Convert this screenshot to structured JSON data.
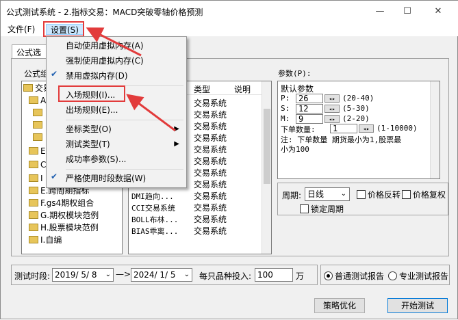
{
  "window": {
    "title": "公式测试系统 - 2.指标交易：MACD突破零轴价格预测",
    "controls": {
      "minimize": "—",
      "maximize": "☐",
      "close": "✕"
    }
  },
  "menubar": {
    "file": "文件(F)",
    "settings": "设置(S)"
  },
  "settings_menu": [
    {
      "label": "自动使用虚拟内存(A)",
      "checked": false
    },
    {
      "label": "强制使用虚拟内存(C)",
      "checked": false
    },
    {
      "label": "禁用虚拟内存(D)",
      "checked": true
    },
    {
      "label": "入场规则(I)...",
      "checked": false
    },
    {
      "label": "出场规则(E)...",
      "checked": false
    },
    {
      "label": "坐标类型(O)",
      "submenu": true
    },
    {
      "label": "测试类型(T)",
      "submenu": true
    },
    {
      "label": "成功率参数(S)...",
      "checked": false
    },
    {
      "label": "严格使用时段数据(W)",
      "checked": true
    }
  ],
  "tabs": {
    "formula_select": "公式选择"
  },
  "formula_group": {
    "label": "公式组",
    "tree": [
      {
        "text": "交易"
      },
      {
        "text": "A"
      },
      {
        "text": ""
      },
      {
        "text": ""
      },
      {
        "text": ""
      },
      {
        "text": "E"
      },
      {
        "text": "C"
      },
      {
        "text": "I"
      },
      {
        "text": "E.跨周期指标"
      },
      {
        "text": "F.gs4期权组合"
      },
      {
        "text": "G.期权模块范例"
      },
      {
        "text": "H.股票模块范例"
      },
      {
        "text": "I.自编"
      }
    ]
  },
  "formula_list": {
    "columns": [
      "类型",
      "说明"
    ],
    "rows": [
      {
        "name": "",
        "type": "交易系统"
      },
      {
        "name": "",
        "type": "交易系统"
      },
      {
        "name": "",
        "type": "交易系统"
      },
      {
        "name": "",
        "type": "交易系统"
      },
      {
        "name": "",
        "type": "交易系统"
      },
      {
        "name": "",
        "type": "交易系统"
      },
      {
        "name": "",
        "type": "交易系统"
      },
      {
        "name": "",
        "type": "交易系统"
      },
      {
        "name": "DMI趋向...",
        "type": "交易系统"
      },
      {
        "name": "CCI交易系统",
        "type": "交易系统"
      },
      {
        "name": "BOLL布林...",
        "type": "交易系统"
      },
      {
        "name": "BIAS乖离...",
        "type": "交易系统"
      }
    ]
  },
  "params": {
    "label": "参数(P):",
    "header": "默认参数",
    "items": [
      {
        "name": "P:",
        "value": "26",
        "range": "(20-40)"
      },
      {
        "name": "S:",
        "value": "12",
        "range": "(5-30)"
      },
      {
        "name": "M:",
        "value": "9",
        "range": "(2-20)"
      }
    ],
    "order_qty": {
      "label": "下单数量:",
      "value": "1",
      "range": "(1-10000)"
    },
    "note_line1": "注: 下单数量 期货最小为1,股票最",
    "note_line2": "小为100"
  },
  "period": {
    "label": "周期:",
    "value": "日线",
    "lock_label": "锁定周期"
  },
  "options": {
    "price_reverse": "价格反转",
    "price_rehabilitate": "价格复权"
  },
  "test_period": {
    "label": "测试时段:",
    "from": "2019/ 5/ 8",
    "to": "2024/ 1/ 5",
    "arrow": "—>"
  },
  "invest": {
    "label": "每只品种投入:",
    "value": "100",
    "unit": "万"
  },
  "report": {
    "normal": "普通测试报告",
    "pro": "专业测试报告"
  },
  "buttons": {
    "optimize": "策略优化",
    "start": "开始测试"
  },
  "colors": {
    "highlight": "#cce8ff",
    "annotation": "#e23b3b",
    "check": "#1f5fb0"
  }
}
